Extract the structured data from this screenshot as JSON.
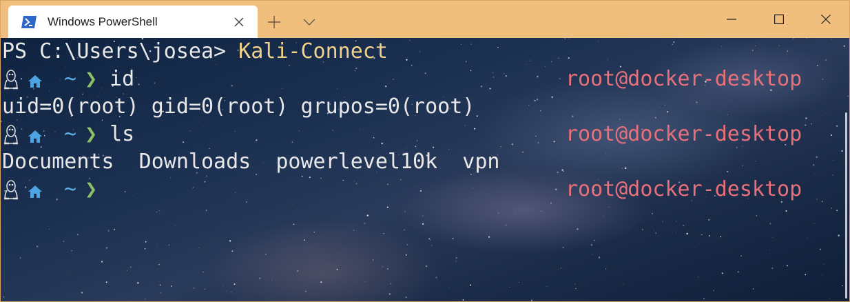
{
  "window": {
    "tab_title": "Windows PowerShell",
    "accent_color": "#f0bf7e"
  },
  "terminal": {
    "lines": [
      {
        "type": "ps",
        "prompt": "PS C:\\Users\\josea> ",
        "command": "Kali-Connect"
      },
      {
        "type": "zsh",
        "dir": "~",
        "chevron": "❯",
        "command": "id",
        "right": "root@docker-desktop"
      },
      {
        "type": "output",
        "text": "uid=0(root) gid=0(root) grupos=0(root)"
      },
      {
        "type": "zsh",
        "dir": "~",
        "chevron": "❯",
        "command": "ls",
        "right": "root@docker-desktop"
      },
      {
        "type": "output",
        "text": "Documents  Downloads  powerlevel10k  vpn"
      },
      {
        "type": "zsh",
        "dir": "~",
        "chevron": "❯",
        "command": "",
        "right": "root@docker-desktop"
      }
    ]
  },
  "icons": {
    "tab": "powershell-icon",
    "close_tab": "close-icon",
    "new_tab": "plus-icon",
    "dropdown": "chevron-down-icon",
    "minimize": "minimize-icon",
    "maximize": "maximize-icon",
    "close_window": "close-icon",
    "prompt_os": "linux-tux-icon",
    "prompt_home": "home-icon"
  }
}
